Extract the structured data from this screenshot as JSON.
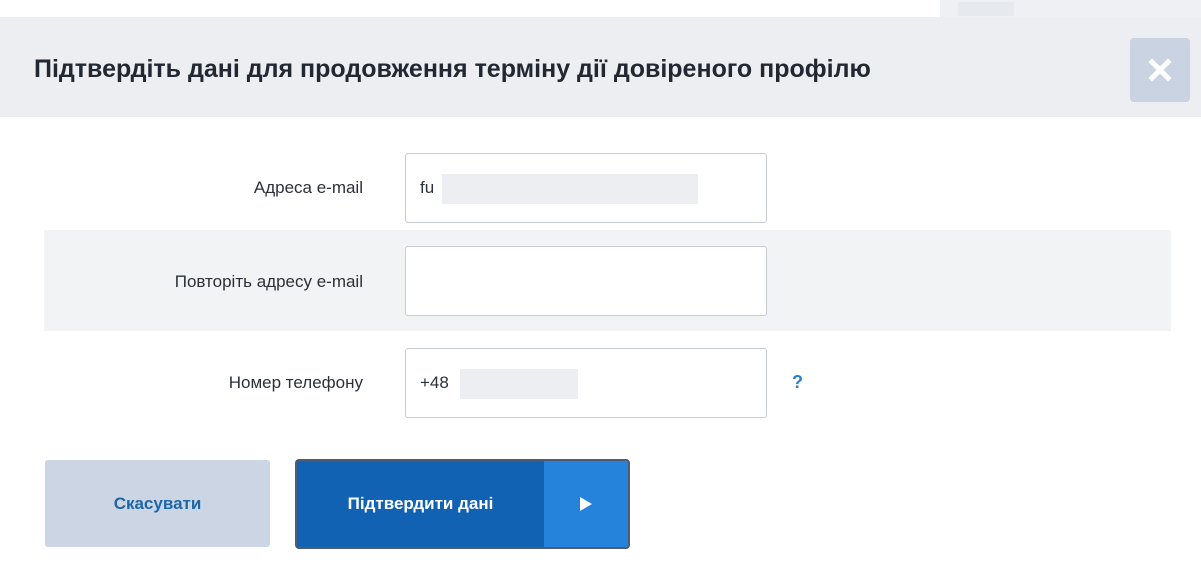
{
  "dialog": {
    "title": "Підтвердіть дані для продовження терміну дії довіреного профілю"
  },
  "form": {
    "email": {
      "label": "Адреса e-mail",
      "value": "fu"
    },
    "email_repeat": {
      "label": "Повторіть адресу e-mail",
      "value": ""
    },
    "phone": {
      "label": "Номер телефону",
      "value": "+48",
      "help": "?"
    }
  },
  "buttons": {
    "cancel": "Скасувати",
    "confirm": "Підтвердити дані"
  },
  "icons": {
    "close": "close-icon",
    "arrow": "play-arrow-icon"
  },
  "colors": {
    "header_bg": "#eceef2",
    "primary": "#1262b3",
    "primary_light": "#2583dc",
    "cancel_bg": "#cbd5e4",
    "accent_text": "#1d66a8"
  }
}
